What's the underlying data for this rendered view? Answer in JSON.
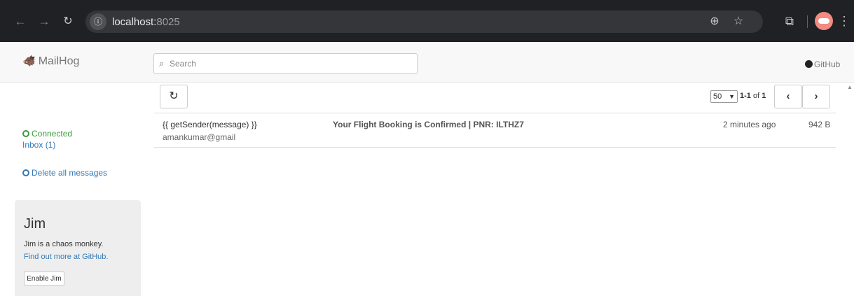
{
  "browser": {
    "url_host": "localhost:",
    "url_port": "8025",
    "site_info_icon": "info-icon",
    "icons": [
      "back-arrow-icon",
      "forward-arrow-icon",
      "reload-icon",
      "zoom-icon",
      "star-icon",
      "extensions-icon",
      "profile-avatar",
      "kebab-menu-icon"
    ]
  },
  "navbar": {
    "brand": "MailHog",
    "search_placeholder": "Search",
    "github_label": "GitHub"
  },
  "sidebar": {
    "status": "Connected",
    "inbox": "Inbox (1)",
    "delete_all": "Delete all messages",
    "jim": {
      "title": "Jim",
      "description": "Jim is a chaos monkey.",
      "link": "Find out more at GitHub.",
      "button": "Enable Jim"
    }
  },
  "toolbar": {
    "per_page": "50",
    "range_bold": "1-1",
    "range_rest": " of ",
    "range_total": "1"
  },
  "messages": [
    {
      "from": "{{ getSender(message) }}",
      "email": "amankumar@gmail",
      "subject": "Your Flight Booking is Confirmed | PNR: ILTHZ7",
      "time": "2 minutes ago",
      "size": "942 B"
    }
  ],
  "colors": {
    "browser_bg": "#202124",
    "omnibox_bg": "#35363a",
    "navbar_bg": "#f8f8f8",
    "link": "#337ab7",
    "connected": "#3c9b3c",
    "brand_logo": "#c0392b"
  }
}
